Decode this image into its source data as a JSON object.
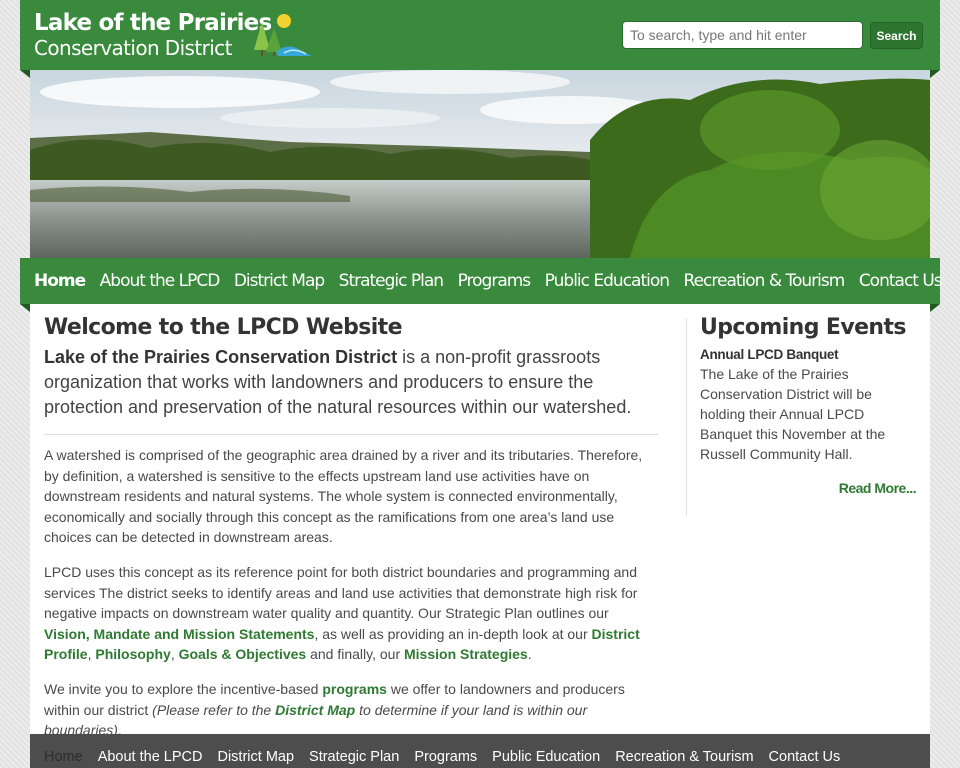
{
  "site": {
    "title_line1": "Lake of the Prairies",
    "title_line2": "Conservation District"
  },
  "search": {
    "placeholder": "To search, type and hit enter",
    "button_label": "Search"
  },
  "nav": {
    "items": [
      {
        "label": "Home",
        "active": true
      },
      {
        "label": "About the LPCD"
      },
      {
        "label": "District Map"
      },
      {
        "label": "Strategic Plan"
      },
      {
        "label": "Programs"
      },
      {
        "label": "Public Education"
      },
      {
        "label": "Recreation & Tourism"
      },
      {
        "label": "Contact Us"
      }
    ]
  },
  "main": {
    "heading": "Welcome to the LPCD Website",
    "lead_bold": "Lake of the Prairies Conservation District",
    "lead_rest": " is a non-profit grassroots organization that works with landowners and producers to ensure the protection and preservation of the natural resources within our watershed.",
    "para1": "A watershed is comprised of the geographic area drained by a river and its tributaries. Therefore, by definition, a watershed is sensitive to the effects upstream land use activities have on downstream residents and natural systems. The whole system is connected environmentally, economically and socially through this concept as the ramifications from one area’s land use choices can be detected in downstream areas.",
    "para2": {
      "text1": "LPCD uses this concept as its reference point for both district boundaries and programming and services The district seeks to identify areas and land use activities that demonstrate high risk for negative impacts on downstream water quality and quantity. Our Strategic Plan outlines our ",
      "link1": "Vision, Mandate and Mission Statements",
      "text2": ", as well as providing an in-depth look at our ",
      "link2": "District Profile",
      "text3": ", ",
      "link3": "Philosophy",
      "text4": ", ",
      "link4": "Goals & Objectives",
      "text5": " and finally, our ",
      "link5": "Mission Strategies",
      "text6": "."
    },
    "para3": {
      "text1": "We invite you to explore the incentive-based ",
      "link1": "programs",
      "text2": " we offer to landowners and producers within our district ",
      "italic1": "(Please refer to the ",
      "link2": "District Map",
      "italic2": " to determine if your land is within our boundaries)",
      "text3": "."
    }
  },
  "sidebar": {
    "heading": "Upcoming Events",
    "event_title": "Annual LPCD Banquet",
    "event_text": "The Lake of the Prairies Conservation District will be holding their Annual LPCD Banquet this November at the Russell Community Hall.",
    "read_more": "Read More..."
  },
  "footer": {
    "items": [
      {
        "label": "Home",
        "active": true
      },
      {
        "label": "About the LPCD"
      },
      {
        "label": "District Map"
      },
      {
        "label": "Strategic Plan"
      },
      {
        "label": "Programs"
      },
      {
        "label": "Public Education"
      },
      {
        "label": "Recreation & Tourism"
      },
      {
        "label": "Contact Us"
      }
    ]
  },
  "colors": {
    "brand_green": "#3a8a3e",
    "link_green": "#2f7a32",
    "footer_gray": "#4d4d4d"
  }
}
